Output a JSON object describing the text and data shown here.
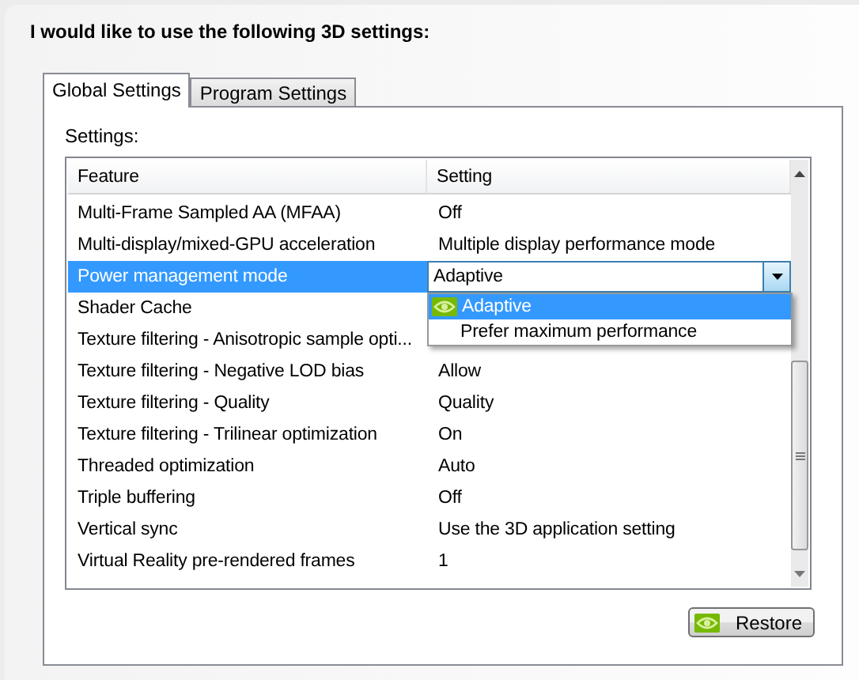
{
  "heading": "I would like to use the following 3D settings:",
  "tabs": [
    {
      "label": "Global Settings",
      "selected": true
    },
    {
      "label": "Program Settings",
      "selected": false
    }
  ],
  "settings_label": "Settings:",
  "table": {
    "columns": [
      "Feature",
      "Setting"
    ],
    "rows": [
      {
        "feature": "Multi-Frame Sampled AA (MFAA)",
        "setting": "Off",
        "selected": false,
        "kind": "text"
      },
      {
        "feature": "Multi-display/mixed-GPU acceleration",
        "setting": "Multiple display performance mode",
        "selected": false,
        "kind": "text"
      },
      {
        "feature": "Power management mode",
        "setting": "Adaptive",
        "selected": true,
        "kind": "combo",
        "options": [
          {
            "label": "Adaptive",
            "selected": true,
            "recommended": true
          },
          {
            "label": "Prefer maximum performance",
            "selected": false,
            "recommended": false
          }
        ]
      },
      {
        "feature": "Shader Cache",
        "selected": false,
        "kind": "text"
      },
      {
        "feature": "Texture filtering - Anisotropic sample opti...",
        "selected": false,
        "kind": "text"
      },
      {
        "feature": "Texture filtering - Negative LOD bias",
        "setting": "Allow",
        "selected": false,
        "kind": "text"
      },
      {
        "feature": "Texture filtering - Quality",
        "setting": "Quality",
        "selected": false,
        "kind": "text"
      },
      {
        "feature": "Texture filtering - Trilinear optimization",
        "setting": "On",
        "selected": false,
        "kind": "text"
      },
      {
        "feature": "Threaded optimization",
        "setting": "Auto",
        "selected": false,
        "kind": "text"
      },
      {
        "feature": "Triple buffering",
        "setting": "Off",
        "selected": false,
        "kind": "text"
      },
      {
        "feature": "Vertical sync",
        "setting": "Use the 3D application setting",
        "selected": false,
        "kind": "text"
      },
      {
        "feature": "Virtual Reality pre-rendered frames",
        "setting": "1",
        "selected": false,
        "kind": "text"
      }
    ]
  },
  "restore_button": {
    "label": "Restore",
    "icon": true
  }
}
